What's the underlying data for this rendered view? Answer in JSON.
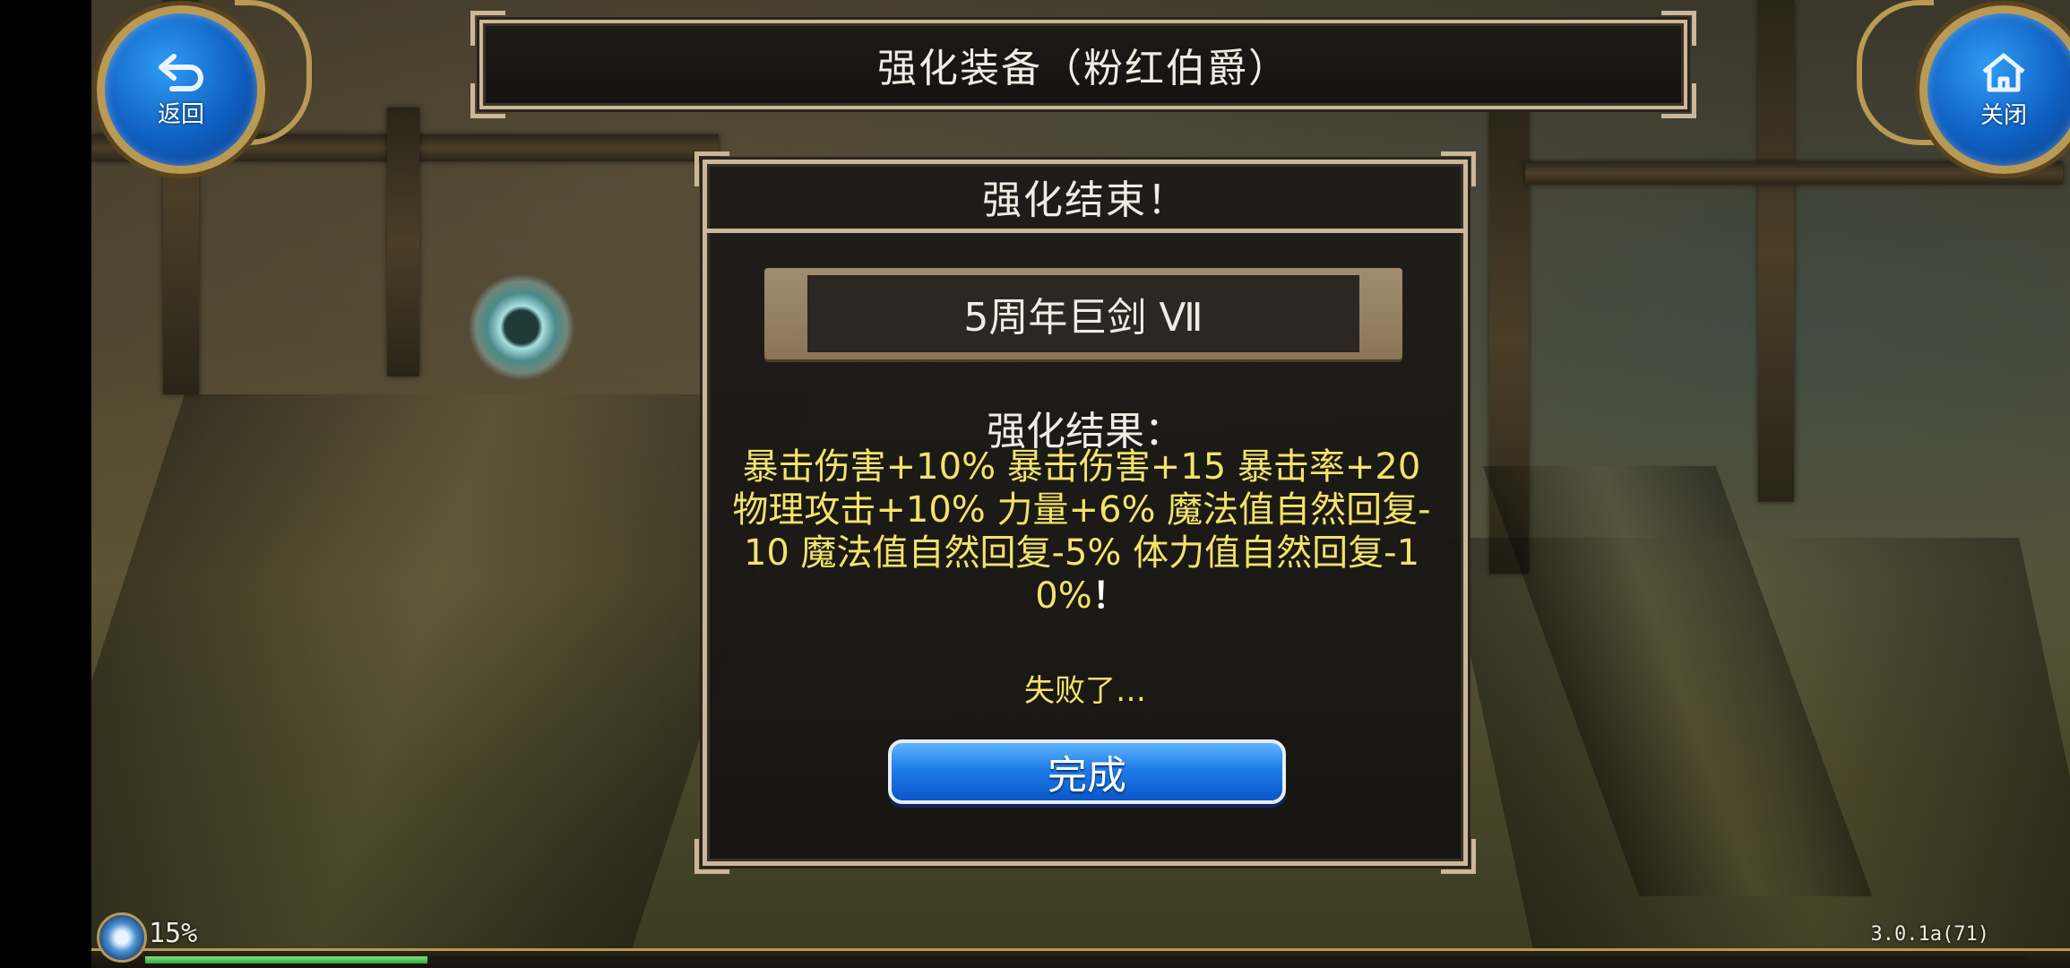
{
  "header": {
    "title": "强化装备（粉红伯爵）"
  },
  "nav": {
    "back_label": "返回",
    "back_icon": "back-arrow-icon",
    "close_label": "关闭",
    "close_icon": "home-icon"
  },
  "dialog": {
    "title": "强化结束！",
    "item_name": "5周年巨剑 Ⅶ",
    "result_label": "强化结果：",
    "result_text": "暴击伤害+10% 暴击伤害+15 暴击率+20 物理攻击+10% 力量+6% 魔法值自然回复-10 魔法值自然回复-5% 体力值自然回复-10%",
    "result_suffix": "！",
    "status_text": "失败了…",
    "done_label": "完成"
  },
  "footer": {
    "progress_text": "15%",
    "progress_value": 0.15,
    "version": "3.0.1a(71)"
  },
  "colors": {
    "frame": "#cbb79a",
    "result_yellow": "#f2e36a",
    "button_blue": "#1f7de8",
    "progress_green": "#2ea83a"
  }
}
